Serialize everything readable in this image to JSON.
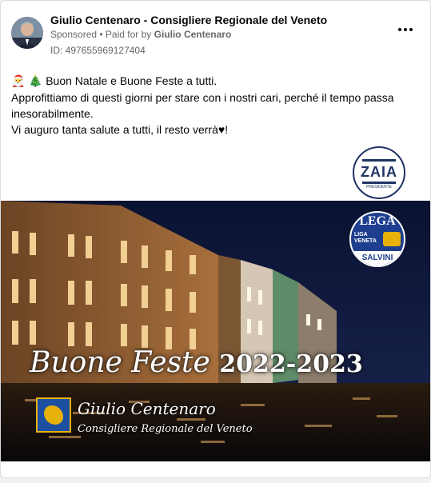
{
  "post": {
    "page_name": "Giulio Centenaro - Consigliere Regionale del Veneto",
    "sponsored": "Sponsored",
    "separator": " • ",
    "paid_for_prefix": "Paid for by ",
    "paid_for_name": "Giulio Centenaro",
    "ad_id": "ID: 497655969127404",
    "more_icon": "more-options-icon"
  },
  "body": {
    "line1_emoji": "🎅 🎄",
    "line1_text": " Buon Natale e Buone Feste a tutti.",
    "line2": "Approfittiamo di questi giorni per stare con i nostri cari, perché il tempo passa inesorabilmente.",
    "line3": "Vi auguro tanta salute a tutti, il resto verrà♥!"
  },
  "creative": {
    "greeting_words": "Buone Feste",
    "greeting_years": "2022-2023",
    "signature_name": "Giulio Centenaro",
    "signature_role": "Consigliere Regionale del Veneto",
    "zaia_logo_text": "ZAIA",
    "zaia_logo_sub": "PRESIDENTE",
    "lega_logo_top": "LEGA",
    "lega_logo_sub1": "LIGA",
    "lega_logo_sub2": "VENETA",
    "lega_logo_bottom": "SALVINI"
  },
  "colors": {
    "page_background": "#f0f2f5",
    "text_primary": "#050505",
    "text_secondary": "#65676b",
    "night_sky": "#0b1130",
    "zaia_blue": "#1f3364",
    "lega_blue": "#1e3f8f",
    "gold": "#e7b10a"
  }
}
